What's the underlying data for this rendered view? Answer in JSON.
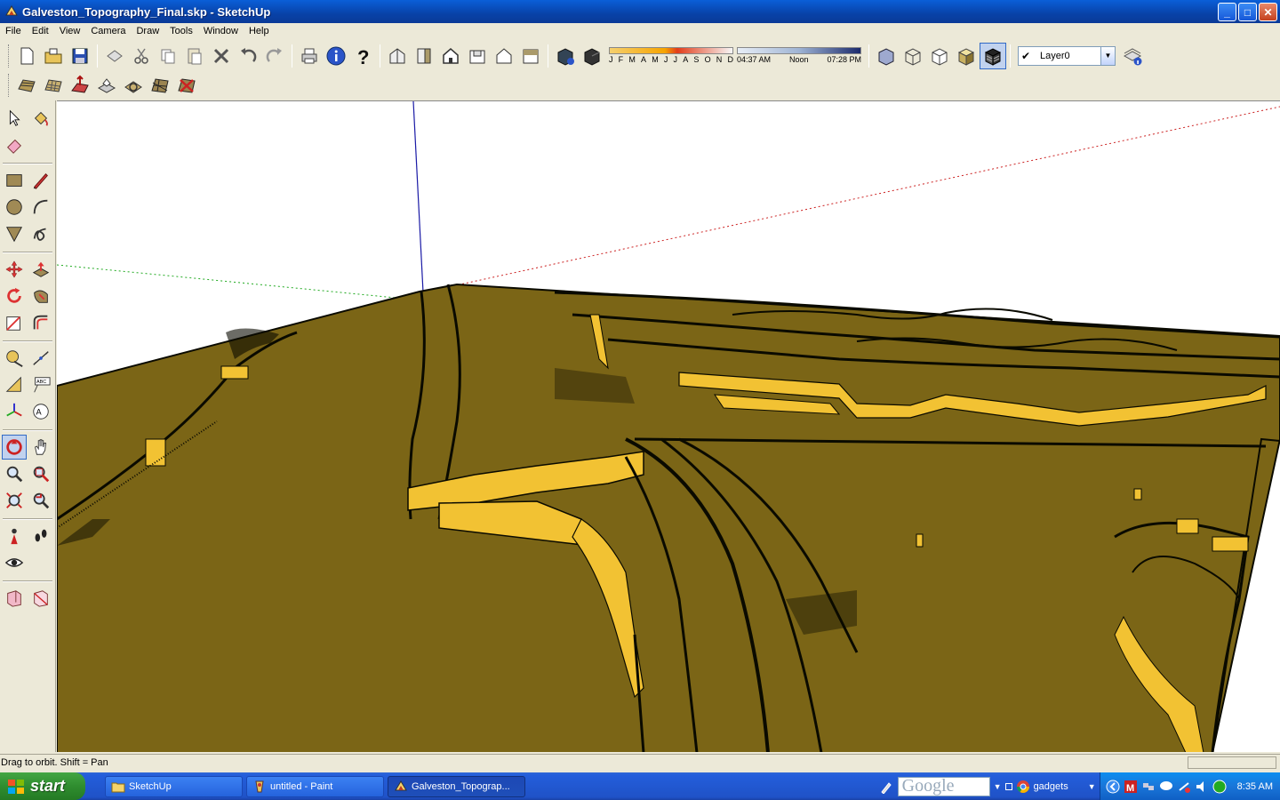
{
  "window": {
    "title": "Galveston_Topography_Final.skp - SketchUp",
    "buttons": {
      "minimize": "_",
      "maximize": "□",
      "close": "✕"
    }
  },
  "menu": [
    "File",
    "Edit",
    "View",
    "Camera",
    "Draw",
    "Tools",
    "Window",
    "Help"
  ],
  "shadows": {
    "months": [
      "J",
      "F",
      "M",
      "A",
      "M",
      "J",
      "J",
      "A",
      "S",
      "O",
      "N",
      "D"
    ],
    "time_start": "04:37 AM",
    "time_mid": "Noon",
    "time_end": "07:28 PM"
  },
  "layer": {
    "name": "Layer0",
    "visible": true,
    "check": "✔"
  },
  "status": {
    "text": "Drag to orbit.  Shift = Pan"
  },
  "taskbar": {
    "start": "start",
    "tasks": [
      {
        "label": "SketchUp",
        "icon": "folder-icon"
      },
      {
        "label": "untitled - Paint",
        "icon": "paint-icon"
      },
      {
        "label": "Galveston_Topograp...",
        "icon": "sketchup-icon"
      }
    ],
    "search_brand": "Google",
    "gadgets": "gadgets",
    "clock": "8:35 AM"
  },
  "colors": {
    "terrain": "#7b6516",
    "terrain_edge": "#0a0a00",
    "contour_face": "#f2c233",
    "axis_blue": "#1a1aa6",
    "axis_red": "#cc2222",
    "axis_green": "#22aa22"
  }
}
